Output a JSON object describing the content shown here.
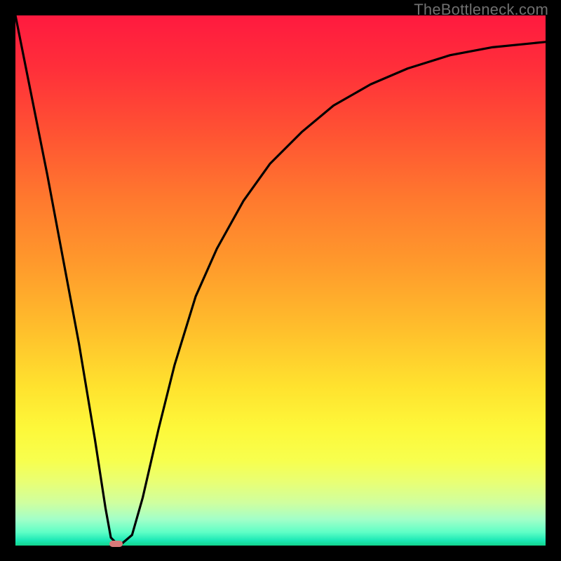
{
  "watermark": "TheBottleneck.com",
  "chart_data": {
    "type": "line",
    "title": "",
    "xlabel": "",
    "ylabel": "",
    "xlim": [
      0,
      100
    ],
    "ylim": [
      0,
      100
    ],
    "series": [
      {
        "name": "curve",
        "x": [
          0,
          6,
          12,
          15,
          17,
          18,
          19,
          20,
          22,
          24,
          27,
          30,
          34,
          38,
          43,
          48,
          54,
          60,
          67,
          74,
          82,
          90,
          100
        ],
        "values": [
          100,
          70,
          38,
          20,
          7,
          1.5,
          0.5,
          0.3,
          2,
          9,
          22,
          34,
          47,
          56,
          65,
          72,
          78,
          83,
          87,
          90,
          92.5,
          94,
          95
        ]
      }
    ],
    "marker": {
      "x": 19,
      "y": 0.3,
      "w_pct": 2.6,
      "h_pct": 1.2,
      "color": "#d97a7a"
    }
  },
  "colors": {
    "background": "#000000",
    "curve": "#000000",
    "marker": "#d97a7a",
    "watermark": "#707070"
  }
}
